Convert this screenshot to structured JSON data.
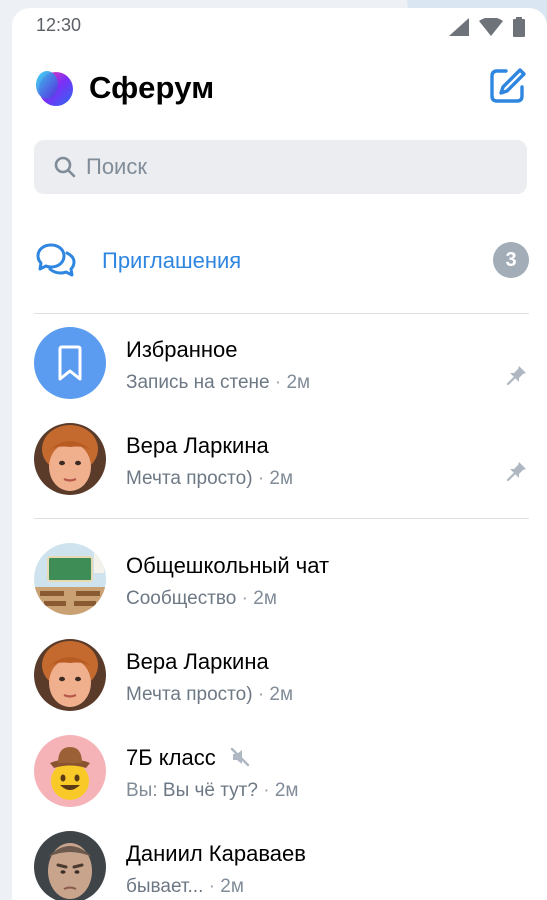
{
  "status_bar": {
    "time": "12:30"
  },
  "header": {
    "title": "Сферум"
  },
  "search": {
    "placeholder": "Поиск"
  },
  "invitations": {
    "label": "Приглашения",
    "count": "3"
  },
  "chats": [
    {
      "name": "Избранное",
      "preview": "Запись на стене",
      "time": "2м",
      "pinned": true,
      "avatar": "bookmark-icon"
    },
    {
      "name": "Вера Ларкина",
      "preview": "Мечта просто)",
      "time": "2м",
      "pinned": true,
      "avatar": "photo"
    },
    {
      "name": "Общешкольный чат",
      "preview": "Сообщество",
      "time": "2м",
      "pinned": false,
      "avatar": "classroom"
    },
    {
      "name": "Вера Ларкина",
      "preview": "Мечта просто)",
      "time": "2м",
      "pinned": false,
      "avatar": "photo"
    },
    {
      "name": "7Б класс",
      "author": "Вы:",
      "preview": "Вы чё тут?",
      "time": "2м",
      "muted": true,
      "pinned": false,
      "avatar": "cowboy-emoji"
    },
    {
      "name": "Даниил Караваев",
      "preview": "бывает...",
      "time": "2м",
      "pinned": false,
      "avatar": "photo"
    }
  ],
  "separator": "·",
  "colors": {
    "accent": "#2f86e0",
    "badge": "#a3adb8",
    "secondary_text": "#818c99"
  }
}
